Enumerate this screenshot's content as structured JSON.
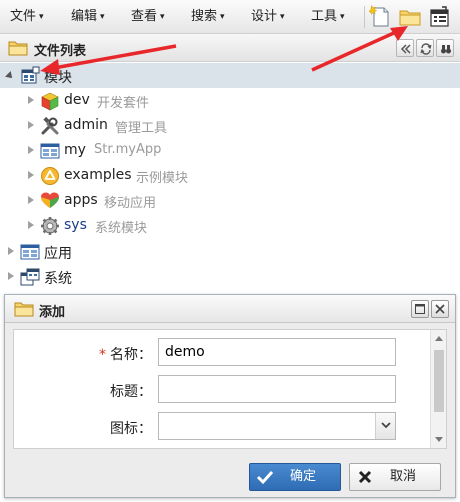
{
  "menubar": {
    "items": [
      {
        "label": "文件"
      },
      {
        "label": "编辑"
      },
      {
        "label": "查看"
      },
      {
        "label": "搜索"
      },
      {
        "label": "设计"
      },
      {
        "label": "工具"
      }
    ],
    "caret": "▾"
  },
  "panel": {
    "title": "文件列表"
  },
  "tree": {
    "root": {
      "name": "模块",
      "icon": "module-icon",
      "expanded": true,
      "selected": true
    },
    "children": [
      {
        "name": "dev",
        "desc": "开发套件",
        "icon": "cube-icon"
      },
      {
        "name": "admin",
        "desc": "管理工具",
        "icon": "tools-icon"
      },
      {
        "name": "my",
        "desc": "Str.myApp",
        "icon": "window-icon"
      },
      {
        "name": "examples",
        "desc": "示例模块",
        "icon": "examples-icon"
      },
      {
        "name": "apps",
        "desc": "移动应用",
        "icon": "apps-icon"
      },
      {
        "name": "sys",
        "desc": "系统模块",
        "icon": "gear-icon"
      }
    ],
    "siblings": [
      {
        "name": "应用",
        "icon": "window-icon"
      },
      {
        "name": "系统",
        "icon": "system-icon"
      }
    ]
  },
  "dialog": {
    "title": "添加",
    "fields": {
      "name": {
        "label": "名称：",
        "value": "demo",
        "required": true
      },
      "title": {
        "label": "标题：",
        "value": ""
      },
      "icon": {
        "label": "图标：",
        "value": ""
      }
    },
    "ok_label": "确定",
    "cancel_label": "取消"
  },
  "colors": {
    "annotation_arrow": "#e8272a",
    "ok_button": "#2e6cb3",
    "selected_row": "#dbe3ea"
  }
}
